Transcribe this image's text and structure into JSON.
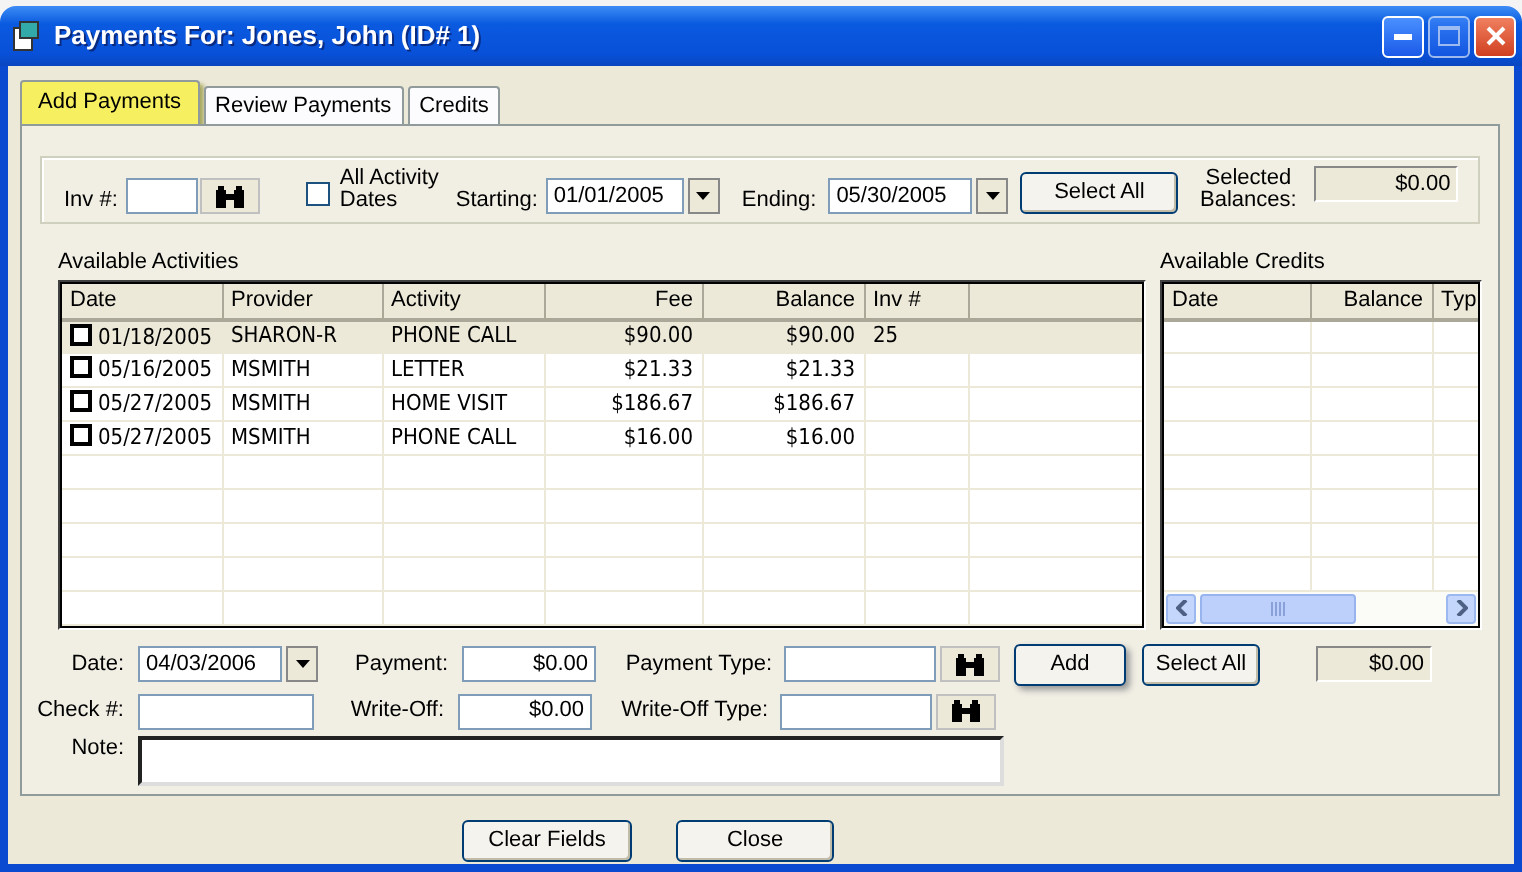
{
  "window": {
    "title": "Payments For: Jones, John (ID# 1)"
  },
  "tabs": [
    {
      "label": "Add Payments",
      "selected": true
    },
    {
      "label": "Review Payments",
      "selected": false
    },
    {
      "label": "Credits",
      "selected": false
    }
  ],
  "filter": {
    "invoice": {
      "label": "Inv #:"
    },
    "all_dates": {
      "label": "All Activity Dates",
      "checked": false
    },
    "starting": {
      "label": "Starting:",
      "value": "01/01/2005"
    },
    "ending": {
      "label": "Ending:",
      "value": "05/30/2005"
    },
    "select_all_button": "Select All",
    "selected_balances": {
      "label": "Selected Balances:",
      "value": "$0.00"
    }
  },
  "activities": {
    "title": "Available Activities",
    "columns": [
      "Date",
      "Provider",
      "Activity",
      "Fee",
      "Balance",
      "Inv #"
    ],
    "rows": [
      {
        "checked": false,
        "selected": true,
        "cells": [
          "01/18/2005",
          "SHARON-R",
          "PHONE CALL",
          "$90.00",
          "$90.00",
          "25"
        ]
      },
      {
        "checked": false,
        "selected": false,
        "cells": [
          "05/16/2005",
          "MSMITH",
          "LETTER",
          "$21.33",
          "$21.33",
          ""
        ]
      },
      {
        "checked": false,
        "selected": false,
        "cells": [
          "05/27/2005",
          "MSMITH",
          "HOME VISIT",
          "$186.67",
          "$186.67",
          ""
        ]
      },
      {
        "checked": false,
        "selected": false,
        "cells": [
          "05/27/2005",
          "MSMITH",
          "PHONE CALL",
          "$16.00",
          "$16.00",
          ""
        ]
      }
    ]
  },
  "credits": {
    "title": "Available Credits",
    "columns": [
      "Date",
      "Balance",
      "Typ"
    ]
  },
  "form": {
    "date": {
      "label": "Date:",
      "value": "04/03/2006"
    },
    "payment": {
      "label": "Payment:",
      "value": "$0.00"
    },
    "payment_type": {
      "label": "Payment Type:"
    },
    "add_button": "Add",
    "select_all_button": "Select All",
    "credit_total": "$0.00",
    "check": {
      "label": "Check #:"
    },
    "write_off": {
      "label": "Write-Off:",
      "value": "$0.00"
    },
    "write_off_type": {
      "label": "Write-Off Type:"
    },
    "note": {
      "label": "Note:"
    }
  },
  "footer_buttons": [
    "Clear Fields",
    "Close"
  ]
}
